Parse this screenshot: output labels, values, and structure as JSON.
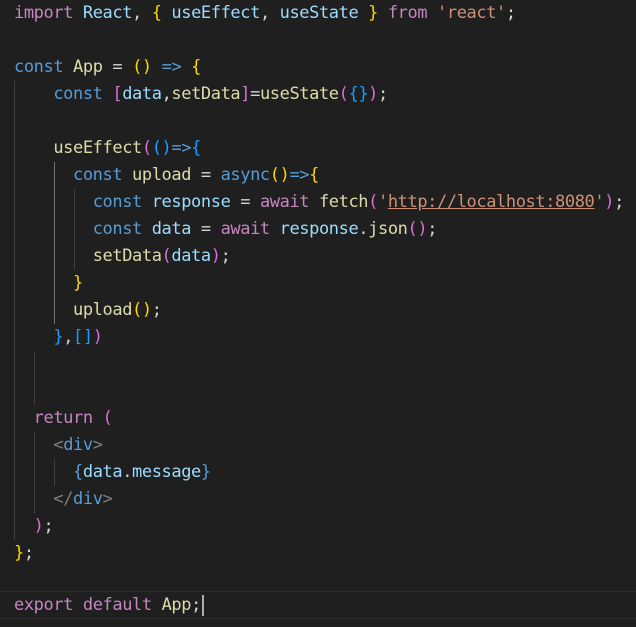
{
  "editor": {
    "language": "javascript-react",
    "theme_background": "#1f1f1f",
    "colors": {
      "keyword_control": "#c586c0",
      "keyword": "#569cd6",
      "variable": "#9cdcfe",
      "function": "#dcdcaa",
      "string": "#ce9178",
      "bracket_level_1": "#ffd700",
      "bracket_level_2": "#da70d6",
      "bracket_level_3": "#179fff"
    },
    "lines": [
      "import React, { useEffect, useState } from 'react';",
      "",
      "const App = () => {",
      "    const [data,setData]=useState({});",
      "",
      "    useEffect(()=>{",
      "      const upload = async()=>{",
      "        const response = await fetch('http://localhost:8080');",
      "        const data = await response.json();",
      "        setData(data);",
      "      }",
      "      upload();",
      "    },[])",
      "",
      "",
      "  return (",
      "    <div>",
      "      {data.message}",
      "    </div>",
      "  );",
      "};",
      "",
      "export default App;"
    ],
    "t": {
      "import": "import",
      "react": "React",
      "comma": ",",
      "useEffect": "useEffect",
      "useState": "useState",
      "from": "from",
      "react_str": "'react'",
      "semi": ";",
      "const": "const",
      "app": "App",
      "eq": "=",
      "arrow": "=>",
      "data": "data",
      "setData": "setData",
      "upload": "upload",
      "async": "async",
      "response": "response",
      "await": "await",
      "fetch": "fetch",
      "url": "http://localhost:8080",
      "json": "json",
      "dot": ".",
      "message": "message",
      "return": "return",
      "div": "div",
      "export": "export",
      "default": "default",
      "ob": "{",
      "cb": "}",
      "op": "(",
      "cp": ")",
      "osb": "[",
      "csb": "]",
      "q": "'",
      "lt": "<",
      "gt": ">",
      "slash": "/"
    }
  }
}
